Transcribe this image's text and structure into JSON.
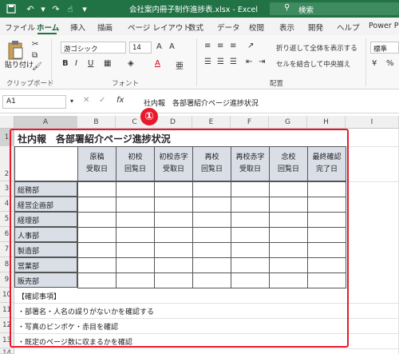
{
  "titlebar": {
    "filename": "会社案内冊子制作進捗表.xlsx",
    "separator": "-",
    "app": "Excel",
    "search_placeholder": "検索",
    "accent": "#217346"
  },
  "tabs": [
    "ファイル",
    "ホーム",
    "挿入",
    "描画",
    "ページ レイアウト",
    "数式",
    "データ",
    "校閲",
    "表示",
    "開発",
    "ヘルプ",
    "Power P"
  ],
  "ribbon": {
    "paste_label": "貼り付け",
    "clipboard_label": "クリップボード",
    "font_name": "游ゴシック",
    "font_size": "14",
    "font_group_label": "フォント",
    "wrap_text": "折り返して全体を表示する",
    "merge_center": "セルを結合して中央揃え",
    "alignment_label": "配置",
    "number_format": "標準"
  },
  "formula_bar": {
    "cell_ref": "A1",
    "content": "社内報　各部署紹介ページ進捗状況"
  },
  "columns": [
    "A",
    "B",
    "C",
    "D",
    "E",
    "F",
    "G",
    "H",
    "I"
  ],
  "rows": [
    "1",
    "2",
    "3",
    "4",
    "5",
    "6",
    "7",
    "8",
    "9",
    "10",
    "11",
    "12",
    "13",
    "14"
  ],
  "sheet": {
    "title": "社内報　各部署紹介ページ進捗状況",
    "headers": [
      [
        "原稿",
        "受取日"
      ],
      [
        "初校",
        "回覧日"
      ],
      [
        "初校赤字",
        "受取日"
      ],
      [
        "再校",
        "回覧日"
      ],
      [
        "再校赤字",
        "受取日"
      ],
      [
        "念校",
        "回覧日"
      ],
      [
        "最終確認",
        "完了日"
      ]
    ],
    "departments": [
      "総務部",
      "経営企画部",
      "経理部",
      "人事部",
      "製造部",
      "営業部",
      "販売部"
    ],
    "notes": [
      "【確認事項】",
      "・部署名・人名の誤りがないかを確認する",
      "・写真のピンボケ・赤目を確認",
      "・既定のページ数に収まるかを確認"
    ]
  },
  "callout": {
    "number": "①",
    "color": "#e8192c"
  }
}
